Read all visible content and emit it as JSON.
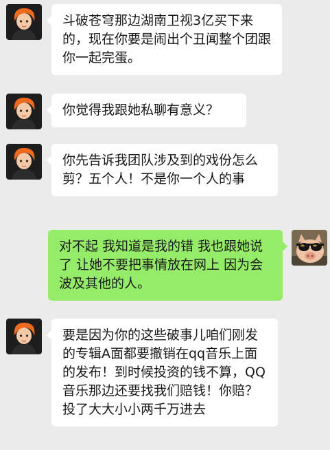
{
  "colors": {
    "background": "#ebebeb",
    "bubble_incoming": "#ffffff",
    "bubble_outgoing": "#95ec69",
    "text": "#191919"
  },
  "messages": [
    {
      "side": "left",
      "avatar_icon": "orange-hair-girl-avatar-icon",
      "text": "斗破苍穹那边湖南卫视3亿买下来的，现在你要是闹出个丑闻整个团跟你一起完蛋。"
    },
    {
      "side": "left",
      "avatar_icon": "orange-hair-girl-avatar-icon",
      "text": "你觉得我跟她私聊有意义？"
    },
    {
      "side": "left",
      "avatar_icon": "orange-hair-girl-avatar-icon",
      "text": "你先告诉我团队涉及到的戏份怎么剪？五个人！不是你一个人的事"
    },
    {
      "side": "right",
      "avatar_icon": "pig-with-sunglasses-avatar-icon",
      "text": "对不起 我知道是我的错 我也跟她说了 让她不要把事情放在网上 因为会波及其他的人。"
    },
    {
      "side": "left",
      "avatar_icon": "orange-hair-girl-avatar-icon",
      "text": "要是因为你的这些破事儿咱们刚发的专辑A面都要撤销在qq音乐上面的发布！到时候投资的钱不算，QQ音乐那边还要找我们赔钱！你赔？投了大大小小两千万进去"
    }
  ]
}
